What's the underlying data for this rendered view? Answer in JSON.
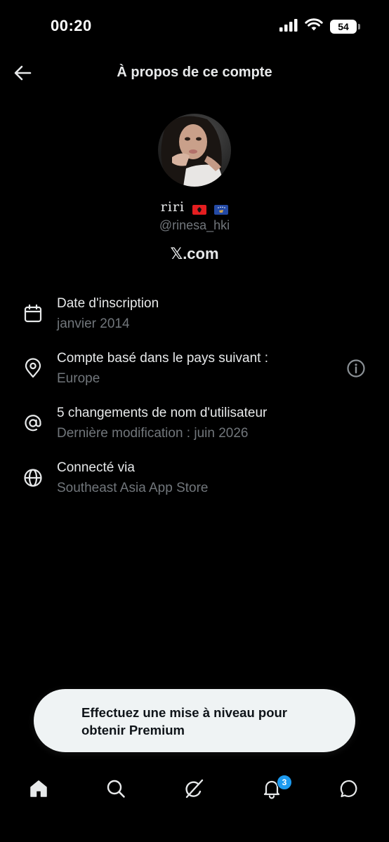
{
  "status_bar": {
    "time": "00:20",
    "battery": "54"
  },
  "header": {
    "title": "À propos de ce compte"
  },
  "profile": {
    "display_name": "riri",
    "flags": [
      "albania-flag",
      "kosovo-flag"
    ],
    "handle": "@rinesa_hki",
    "site": "X.com",
    "site_logo": "𝕏",
    "site_rest": ".com"
  },
  "info": [
    {
      "icon": "calendar-icon",
      "title": "Date d'inscription",
      "value": "janvier 2014"
    },
    {
      "icon": "location-pin-icon",
      "title": "Compte basé dans le pays suivant :",
      "value": "Europe"
    },
    {
      "icon": "at-sign-icon",
      "title": "5 changements de nom d'utilisateur",
      "value": "Dernière modification : juin 2026"
    },
    {
      "icon": "globe-icon",
      "title": "Connecté via",
      "value": "Southeast Asia App Store"
    }
  ],
  "premium_banner": {
    "text": "Effectuez une mise à niveau pour obtenir Premium"
  },
  "bottom_nav": {
    "items": [
      "home-icon",
      "search-icon",
      "grok-icon",
      "notifications-icon",
      "messages-icon"
    ],
    "notification_count": "3"
  },
  "colors": {
    "background": "#000000",
    "primary_text": "#e7e9ea",
    "secondary_text": "#71767b",
    "badge": "#1d9bf0",
    "banner_bg": "#eff3f4"
  }
}
